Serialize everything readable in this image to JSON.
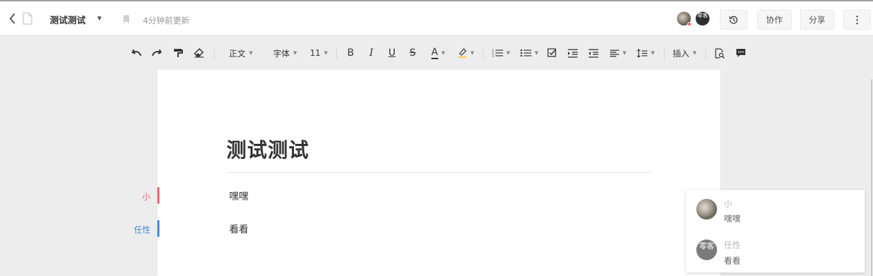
{
  "header": {
    "doc_title": "测试测试",
    "update_time": "4分钟前更新",
    "avatar_2_text": "零客",
    "collab_label": "协作",
    "share_label": "分享"
  },
  "toolbar": {
    "style_label": "正文",
    "font_label": "字体",
    "size_label": "11",
    "insert_label": "插入",
    "bold": "B",
    "italic": "I",
    "underline": "U",
    "strike": "S",
    "font_color": "A"
  },
  "document": {
    "heading": "测试测试",
    "paragraphs": [
      {
        "author": "小",
        "text": "嘿嘿",
        "color": "#e0656f"
      },
      {
        "author": "任性",
        "text": "看看",
        "color": "#4a88d8"
      }
    ]
  },
  "comments": [
    {
      "name": "小",
      "text": "嘿嘿"
    },
    {
      "name": "任性",
      "text": "看看",
      "avatar_text": "零客"
    }
  ]
}
